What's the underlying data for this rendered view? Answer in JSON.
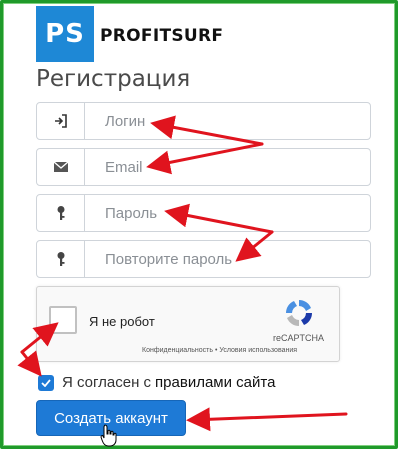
{
  "brand": {
    "logo_letters": "PS",
    "name": "PROFITSURF",
    "accent": "#1e88d6"
  },
  "page": {
    "title": "Регистрация"
  },
  "form": {
    "fields": [
      {
        "icon": "login-icon",
        "placeholder": "Логин",
        "type": "text"
      },
      {
        "icon": "envelope-icon",
        "placeholder": "Email",
        "type": "email"
      },
      {
        "icon": "key-icon",
        "placeholder": "Пароль",
        "type": "password"
      },
      {
        "icon": "key-icon",
        "placeholder": "Повторите пароль",
        "type": "password"
      }
    ],
    "captcha": {
      "label": "Я не робот",
      "brand": "reCAPTCHA",
      "links": "Конфиденциальность • Условия использования",
      "checked": false
    },
    "agree": {
      "checked": true,
      "text": "Я согласен с",
      "link_text": "правилами сайта"
    },
    "submit_label": "Создать аккаунт"
  },
  "colors": {
    "frame": "#1f9a2a",
    "annotation_arrow": "#e0141e",
    "button": "#1e7ad6"
  }
}
